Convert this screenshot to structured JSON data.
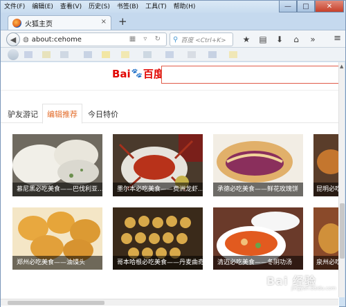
{
  "menubar": {
    "items": [
      "文件(F)",
      "编辑(E)",
      "查看(V)",
      "历史(S)",
      "书签(B)",
      "工具(T)",
      "帮助(H)"
    ]
  },
  "window_controls": {
    "minimize": "—",
    "maximize": "□",
    "close": "✕"
  },
  "tab": {
    "title": "火狐主页",
    "close": "×",
    "new_tab": "+"
  },
  "navbar": {
    "url": "about:cehome",
    "search_placeholder": "百度 <Ctrl+K>",
    "tools": [
      "★",
      "▤",
      "⬇",
      "⌂",
      "»"
    ],
    "menu": "≡"
  },
  "page": {
    "logo": {
      "bai": "Bai",
      "paw": "🐾",
      "du": "百度"
    },
    "tabs": [
      "驴友游记",
      "编辑推荐",
      "今日特价"
    ],
    "active_tab": "编辑推荐",
    "cards": [
      {
        "caption": "慕尼黑必吃美食——巴伐利亚..."
      },
      {
        "caption": "墨尔本必吃美食——费洲龙虾..."
      },
      {
        "caption": "承德必吃美食——鲜花玫瑰饼"
      },
      {
        "caption": "昆明必吃..."
      },
      {
        "caption": "郑州必吃美食——油馍头"
      },
      {
        "caption": "哥本哈根必吃美食——丹麦曲奇"
      },
      {
        "caption": "清迈必吃美食——冬阴功汤"
      },
      {
        "caption": "泉州必吃..."
      }
    ]
  },
  "watermark": {
    "text": "Bai 经验",
    "sub": "jingyan.baidu.com"
  },
  "colors": {
    "accent": "#e36c2a",
    "baidu_red": "#e10602",
    "baidu_blue": "#2932e1"
  }
}
